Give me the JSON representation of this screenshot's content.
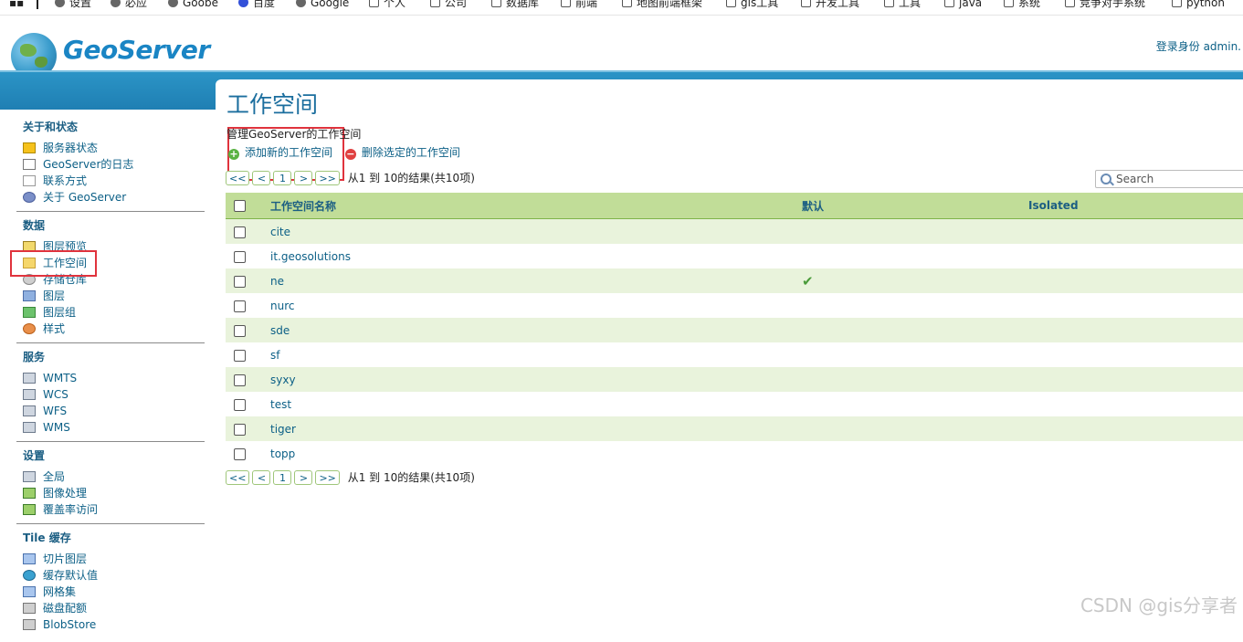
{
  "bookmarks": [
    {
      "label": "设置",
      "icon": "gear-icon"
    },
    {
      "label": "必应",
      "icon": "globe-icon"
    },
    {
      "label": "Goobe",
      "icon": "globe-icon"
    },
    {
      "label": "百度",
      "icon": "paw-icon"
    },
    {
      "label": "Google",
      "icon": "globe-icon"
    },
    {
      "label": "个人",
      "icon": "folder-icon"
    },
    {
      "label": "公司",
      "icon": "folder-icon"
    },
    {
      "label": "数据库",
      "icon": "folder-icon"
    },
    {
      "label": "前端",
      "icon": "folder-icon"
    },
    {
      "label": "地图前端框架",
      "icon": "folder-icon"
    },
    {
      "label": "gis工具",
      "icon": "folder-icon"
    },
    {
      "label": "开发工具",
      "icon": "folder-icon"
    },
    {
      "label": "工具",
      "icon": "folder-icon"
    },
    {
      "label": "java",
      "icon": "folder-icon"
    },
    {
      "label": "系统",
      "icon": "folder-icon"
    },
    {
      "label": "竞争对手系统",
      "icon": "folder-icon"
    },
    {
      "label": "python",
      "icon": "folder-icon"
    }
  ],
  "header": {
    "logo_text": "GeoServer",
    "login_text": "登录身份 admin."
  },
  "sidebar": {
    "about": {
      "title": "关于和状态",
      "items": [
        {
          "label": "服务器状态",
          "icon": "warning-icon"
        },
        {
          "label": "GeoServer的日志",
          "icon": "document-icon"
        },
        {
          "label": "联系方式",
          "icon": "contact-icon"
        },
        {
          "label": "关于 GeoServer",
          "icon": "help-icon"
        }
      ]
    },
    "data": {
      "title": "数据",
      "items": [
        {
          "label": "图层预览",
          "icon": "preview-icon"
        },
        {
          "label": "工作空间",
          "icon": "folder-icon"
        },
        {
          "label": "存储仓库",
          "icon": "store-icon"
        },
        {
          "label": "图层",
          "icon": "layer-icon"
        },
        {
          "label": "图层组",
          "icon": "layergroup-icon"
        },
        {
          "label": "样式",
          "icon": "style-icon"
        }
      ]
    },
    "services": {
      "title": "服务",
      "items": [
        {
          "label": "WMTS",
          "icon": "server-icon"
        },
        {
          "label": "WCS",
          "icon": "server-icon"
        },
        {
          "label": "WFS",
          "icon": "server-icon"
        },
        {
          "label": "WMS",
          "icon": "server-icon"
        }
      ]
    },
    "settings": {
      "title": "设置",
      "items": [
        {
          "label": "全局",
          "icon": "server-icon"
        },
        {
          "label": "图像处理",
          "icon": "image-icon"
        },
        {
          "label": "覆盖率访问",
          "icon": "coverage-icon"
        }
      ]
    },
    "tile": {
      "title": "Tile 缓存",
      "items": [
        {
          "label": "切片图层",
          "icon": "tile-icon"
        },
        {
          "label": "缓存默认值",
          "icon": "globe-icon"
        },
        {
          "label": "网格集",
          "icon": "grid-icon"
        },
        {
          "label": "磁盘配额",
          "icon": "disk-icon"
        },
        {
          "label": "BlobStore",
          "icon": "blob-icon"
        }
      ]
    }
  },
  "main": {
    "title": "工作空间",
    "subtitle": "管理GeoServer的工作空间",
    "add_label": "添加新的工作空间",
    "remove_label": "删除选定的工作空间",
    "pager": {
      "first": "<<",
      "prev": "<",
      "page": "1",
      "next": ">",
      "last": ">>",
      "results": "从1 到 10的结果(共10项)"
    },
    "search_placeholder": "Search",
    "columns": {
      "name": "工作空间名称",
      "default": "默认",
      "isolated": "Isolated"
    },
    "rows": [
      {
        "name": "cite",
        "default": false
      },
      {
        "name": "it.geosolutions",
        "default": false
      },
      {
        "name": "ne",
        "default": true
      },
      {
        "name": "nurc",
        "default": false
      },
      {
        "name": "sde",
        "default": false
      },
      {
        "name": "sf",
        "default": false
      },
      {
        "name": "syxy",
        "default": false
      },
      {
        "name": "test",
        "default": false
      },
      {
        "name": "tiger",
        "default": false
      },
      {
        "name": "topp",
        "default": false
      }
    ],
    "default_mark": "✔"
  },
  "watermark": "CSDN @gis分享者",
  "colors": {
    "accent": "#1f7fb3",
    "highlight": "#e0333d",
    "row_alt": "#e9f3dc",
    "header_row": "#c1dd98"
  }
}
